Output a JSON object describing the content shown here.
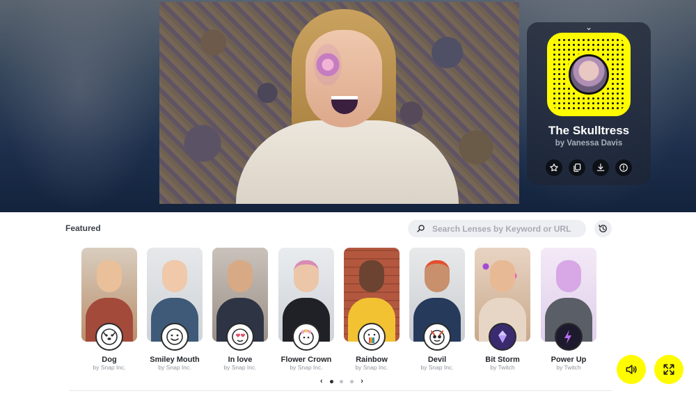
{
  "lens_card": {
    "name": "The Skulltress",
    "author": "by Vanessa Davis",
    "actions": [
      "star-icon",
      "copy-icon",
      "download-icon",
      "report-icon"
    ]
  },
  "featured": {
    "label": "Featured",
    "search_placeholder": "Search Lenses by Keyword or URL"
  },
  "lenses": [
    {
      "name": "Dog",
      "by": "by Snap Inc.",
      "icon": "dog-face-icon"
    },
    {
      "name": "Smiley Mouth",
      "by": "by Snap Inc.",
      "icon": "smiley-mouth-icon"
    },
    {
      "name": "In love",
      "by": "by Snap Inc.",
      "icon": "in-love-icon"
    },
    {
      "name": "Flower Crown",
      "by": "by Snap Inc.",
      "icon": "flower-crown-icon"
    },
    {
      "name": "Rainbow",
      "by": "by Snap Inc.",
      "icon": "rainbow-icon"
    },
    {
      "name": "Devil",
      "by": "by Snap Inc.",
      "icon": "devil-icon"
    },
    {
      "name": "Bit Storm",
      "by": "by Twitch",
      "icon": "bit-storm-icon"
    },
    {
      "name": "Power Up",
      "by": "by Twitch",
      "icon": "power-up-icon"
    }
  ],
  "pager": {
    "prev": "‹",
    "next": "›",
    "pages": 3,
    "current": 1
  },
  "colors": {
    "snap_yellow": "#fffc00",
    "card_bg": "#1e2634"
  }
}
